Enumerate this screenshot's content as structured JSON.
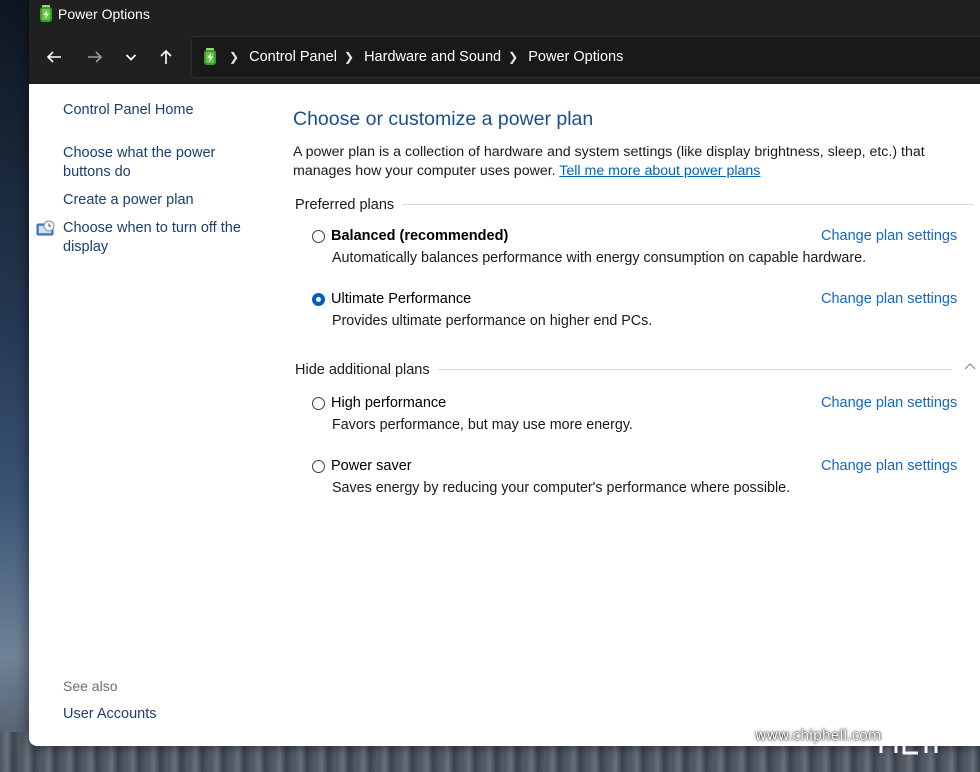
{
  "window": {
    "title": "Power Options",
    "app_icon": "power-options-icon"
  },
  "nav": {
    "back_icon": "arrow-left-icon",
    "forward_icon": "arrow-right-icon",
    "recent_icon": "chevron-down-icon",
    "up_icon": "arrow-up-icon",
    "breadcrumbs": [
      "Control Panel",
      "Hardware and Sound",
      "Power Options"
    ]
  },
  "sidebar": {
    "links": [
      "Control Panel Home",
      "Choose what the power buttons do",
      "Create a power plan",
      "Choose when to turn off the display"
    ],
    "see_also_label": "See also",
    "see_also_links": [
      "User Accounts"
    ]
  },
  "main": {
    "heading": "Choose or customize a power plan",
    "description": "A power plan is a collection of hardware and system settings (like display brightness, sleep, etc.) that manages how your computer uses power.",
    "learn_more_link": "Tell me more about power plans",
    "preferred_label": "Preferred plans",
    "hidden_label": "Hide additional plans",
    "change_label": "Change plan settings",
    "preferred_plans": [
      {
        "name": "Balanced (recommended)",
        "description": "Automatically balances performance with energy consumption on capable hardware.",
        "selected": false
      },
      {
        "name": "Ultimate Performance",
        "description": "Provides ultimate performance on higher end PCs.",
        "selected": true
      }
    ],
    "additional_plans": [
      {
        "name": "High performance",
        "description": "Favors performance, but may use more energy.",
        "selected": false
      },
      {
        "name": "Power saver",
        "description": "Saves energy by reducing your computer's performance where possible.",
        "selected": false
      }
    ]
  },
  "watermark": {
    "text": "www.chiphell.com",
    "logo_text": "chiphell"
  },
  "colors": {
    "titlebar": "#202020",
    "heading": "#1c4d8c",
    "link": "#1766c0",
    "radio_selected": "#005fb8"
  }
}
